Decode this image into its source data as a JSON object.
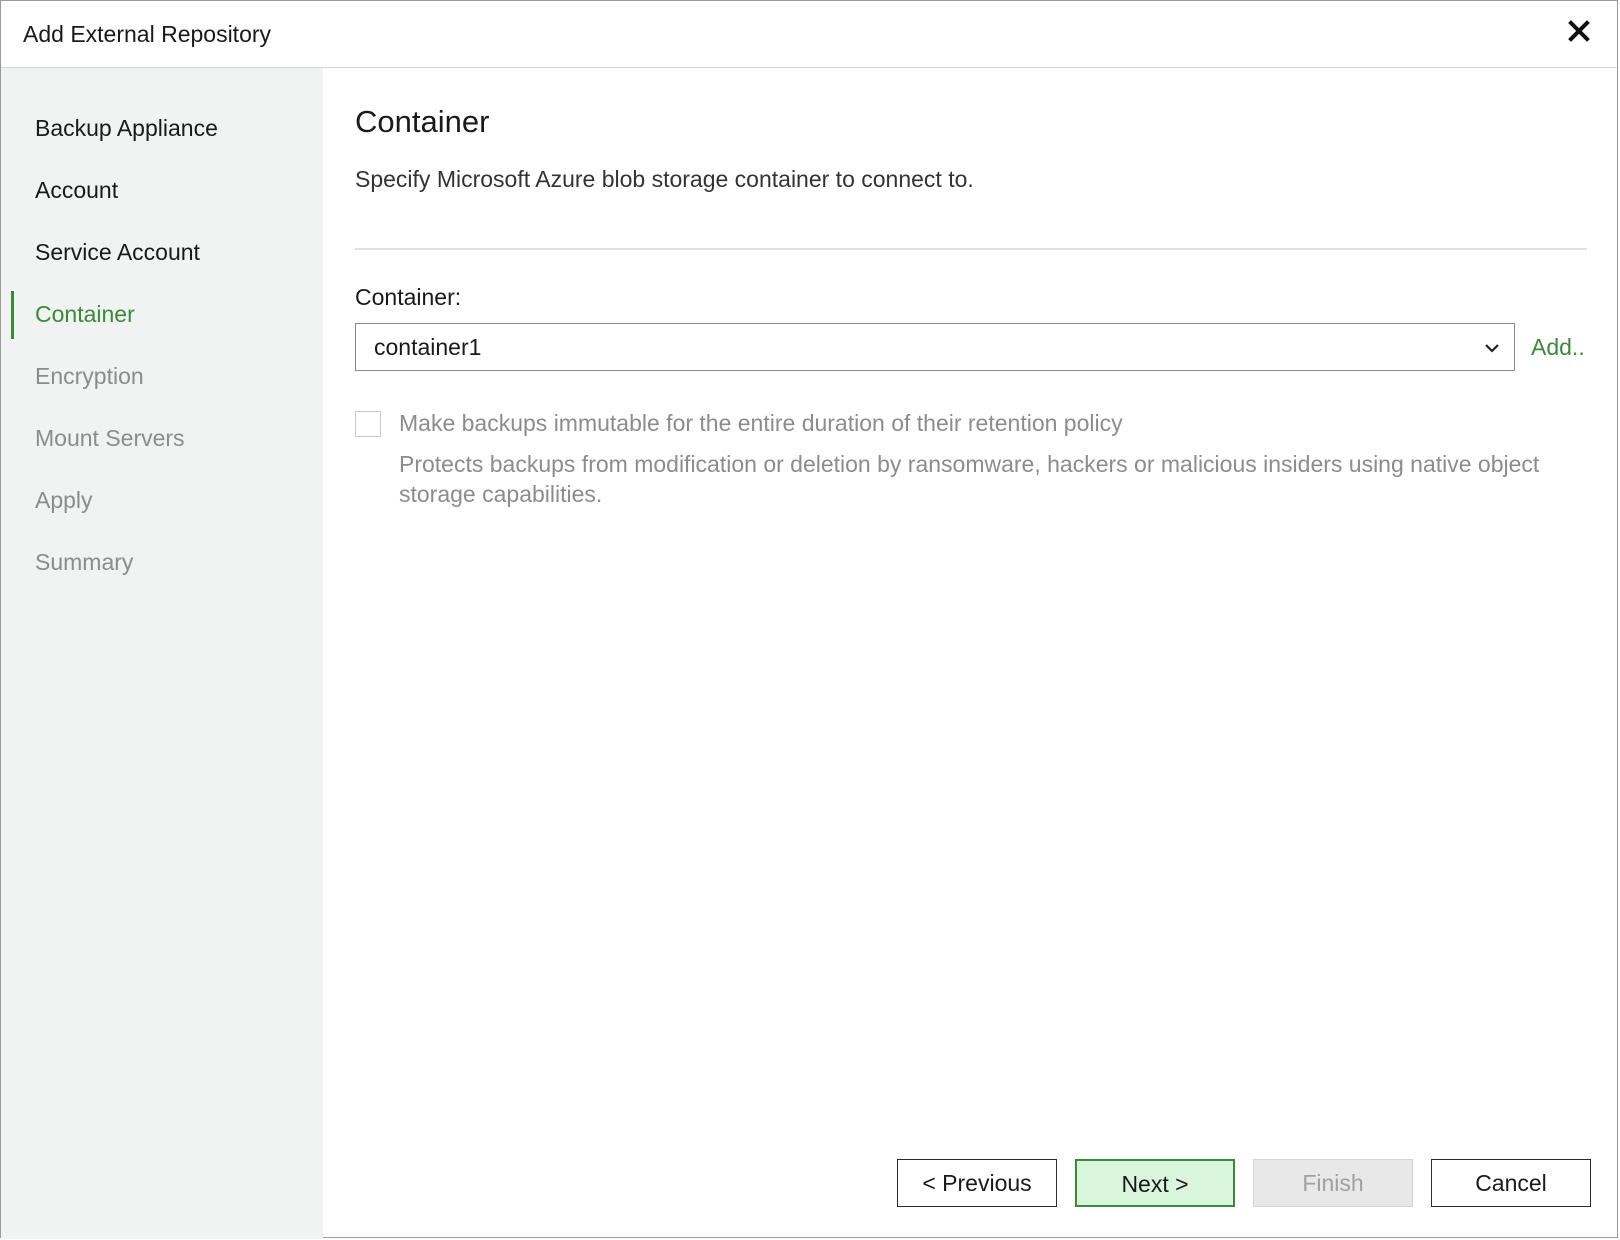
{
  "window": {
    "title": "Add External Repository"
  },
  "sidebar": {
    "steps": [
      {
        "label": "Backup Appliance",
        "state": "done"
      },
      {
        "label": "Account",
        "state": "done"
      },
      {
        "label": "Service Account",
        "state": "done"
      },
      {
        "label": "Container",
        "state": "active"
      },
      {
        "label": "Encryption",
        "state": "future"
      },
      {
        "label": "Mount Servers",
        "state": "future"
      },
      {
        "label": "Apply",
        "state": "future"
      },
      {
        "label": "Summary",
        "state": "future"
      }
    ]
  },
  "main": {
    "title": "Container",
    "description": "Specify Microsoft Azure blob storage container to connect to.",
    "container_label": "Container:",
    "container_value": "container1",
    "add_link": "Add..",
    "immutable_checkbox": {
      "checked": false,
      "enabled": false,
      "label": "Make backups immutable for the entire duration of their retention policy",
      "description": "Protects backups from modification or deletion by ransomware, hackers or malicious insiders using native object storage capabilities."
    }
  },
  "footer": {
    "previous_label": "< Previous",
    "next_label": "Next >",
    "finish_label": "Finish",
    "cancel_label": "Cancel"
  },
  "colors": {
    "accent": "#3a8a3a",
    "sidebar_bg": "#f1f2f2",
    "disabled_text": "#8c8c8c",
    "primary_button_bg": "#d9f5dc"
  }
}
